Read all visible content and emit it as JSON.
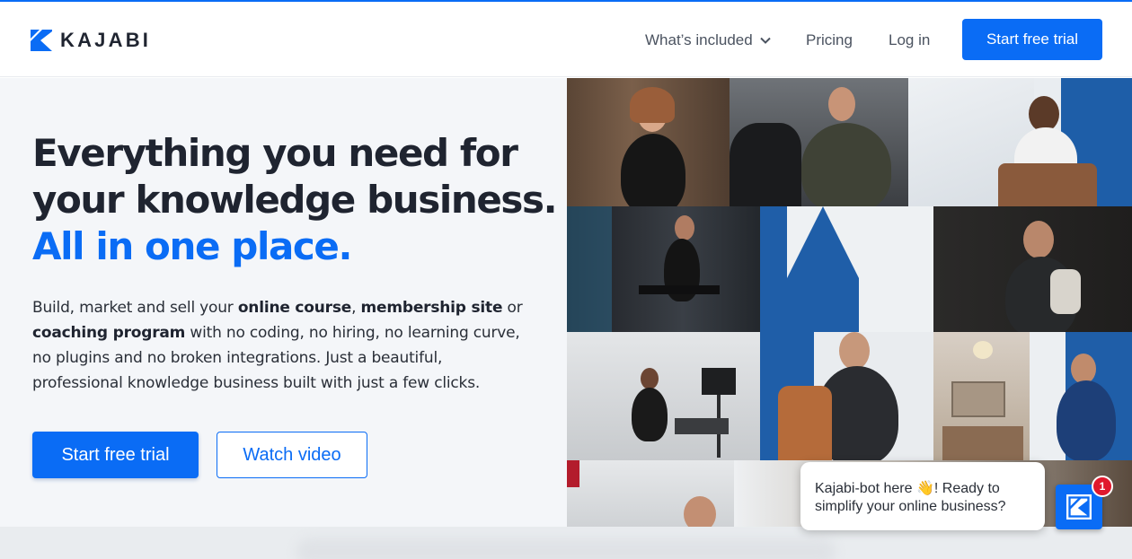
{
  "brand": {
    "name": "KAJABI",
    "color": "#0a6cf5"
  },
  "nav": {
    "items": [
      {
        "label": "What’s included",
        "has_dropdown": true
      },
      {
        "label": "Pricing"
      },
      {
        "label": "Log in"
      }
    ],
    "cta": "Start free trial"
  },
  "hero": {
    "headline": [
      "Everything you need for",
      "your knowledge business."
    ],
    "headline_accent": "All in one place.",
    "body": {
      "p1": "Build, market and sell your ",
      "b1": "online course",
      "p2": ", ",
      "b2": "membership site",
      "p3": " or ",
      "b3": "coaching program",
      "p4": " with no coding, no hiring, no learning curve, no plugins and no broken integrations. Just a beautiful, professional knowledge business built with just a few clicks."
    },
    "primary_button": "Start free trial",
    "secondary_button": "Watch video"
  },
  "chat": {
    "message_pre": "Kajabi-bot here ",
    "emoji": "👋",
    "message_post": "! Ready to simplify your online business?",
    "badge": "1"
  }
}
